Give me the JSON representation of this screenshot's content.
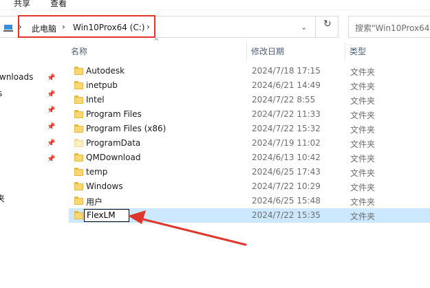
{
  "ribbon": {
    "share": "共享",
    "view": "查看"
  },
  "address": {
    "crumbs": [
      "此电脑",
      "Win10Prox64 (C:)"
    ]
  },
  "search": {
    "placeholder": "搜索\"Win10Prox64"
  },
  "nav": {
    "items": [
      "wnloads",
      "s",
      "夹"
    ]
  },
  "columns": {
    "name": "名称",
    "modified": "修改日期",
    "type": "类型"
  },
  "files": [
    {
      "name": "Autodesk",
      "modified": "2024/7/18 17:15",
      "type": "文件夹"
    },
    {
      "name": "inetpub",
      "modified": "2024/6/21 14:49",
      "type": "文件夹"
    },
    {
      "name": "Intel",
      "modified": "2024/7/22 8:55",
      "type": "文件夹"
    },
    {
      "name": "Program Files",
      "modified": "2024/7/22 11:33",
      "type": "文件夹"
    },
    {
      "name": "Program Files (x86)",
      "modified": "2024/7/22 15:32",
      "type": "文件夹"
    },
    {
      "name": "ProgramData",
      "modified": "2024/7/19 11:02",
      "type": "文件夹"
    },
    {
      "name": "QMDownload",
      "modified": "2024/6/13 10:42",
      "type": "文件夹"
    },
    {
      "name": "temp",
      "modified": "2024/6/25 17:43",
      "type": "文件夹"
    },
    {
      "name": "Windows",
      "modified": "2024/7/22 10:29",
      "type": "文件夹"
    },
    {
      "name": "用户",
      "modified": "2024/6/25 15:48",
      "type": "文件夹"
    },
    {
      "name": "FlexLM",
      "modified": "2024/7/22 15:35",
      "type": "文件夹"
    }
  ],
  "colors": {
    "selection": "#cce8ff",
    "annotation": "#e0352b",
    "folder": "#f8d775"
  }
}
